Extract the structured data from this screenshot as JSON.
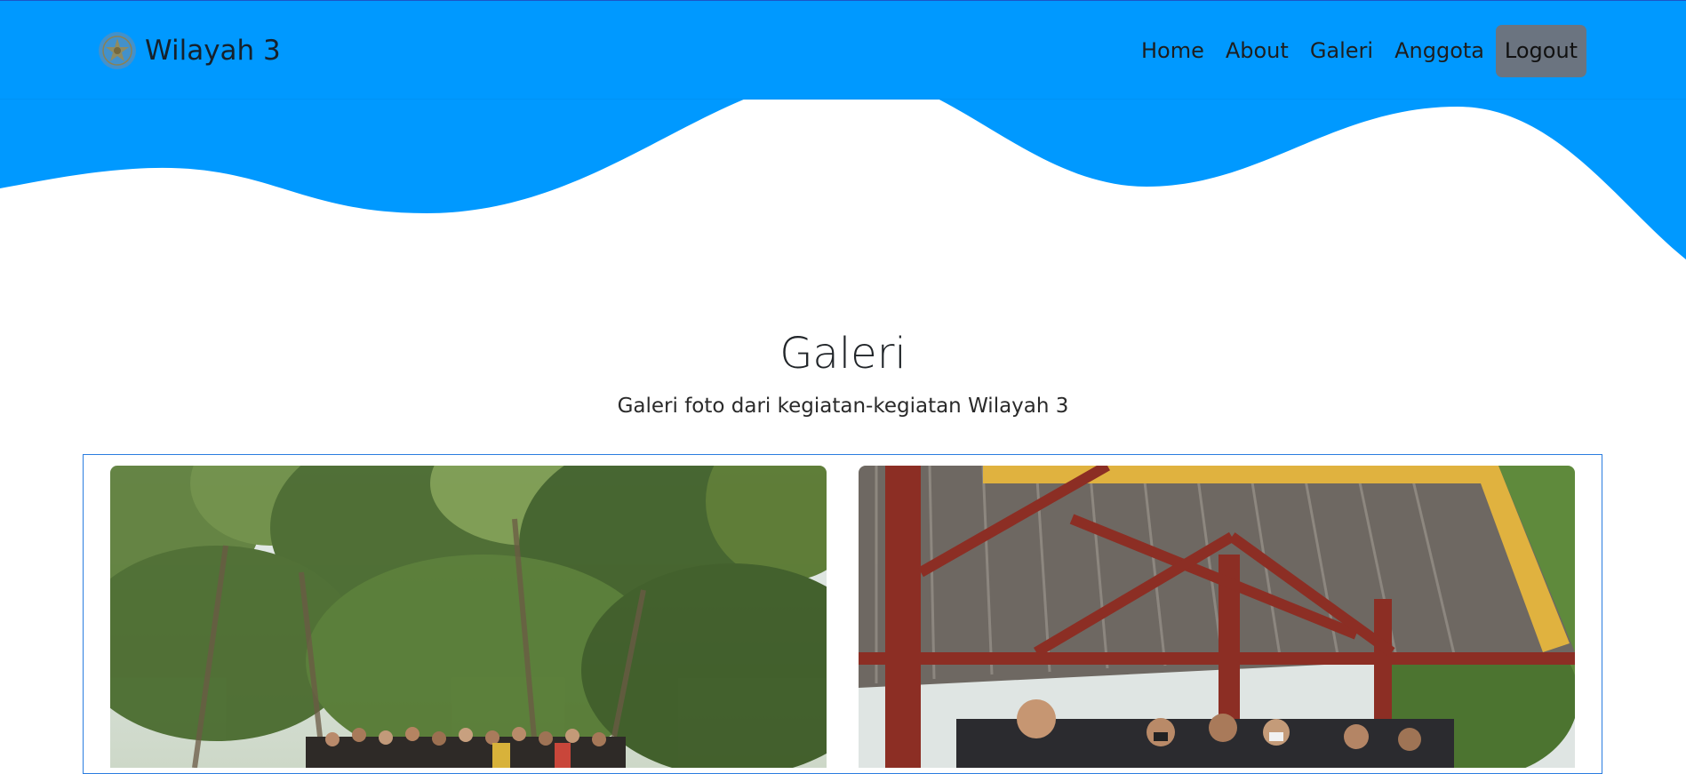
{
  "navbar": {
    "brand_name": "Wilayah 3",
    "brand_logo_icon": "emblem-logo-icon",
    "links": [
      "Home",
      "About",
      "Galeri",
      "Anggota"
    ],
    "logout_label": "Logout",
    "background_color": "#0099ff",
    "logout_color": "#6b7480"
  },
  "gallery": {
    "title": "Galeri",
    "subtitle": "Galeri foto dari kegiatan-kegiatan Wilayah 3",
    "frame_color": "#2b7de0",
    "photos": [
      {
        "subject": "group-photo-in-forest"
      },
      {
        "subject": "group-photo-under-gazebo"
      }
    ]
  }
}
